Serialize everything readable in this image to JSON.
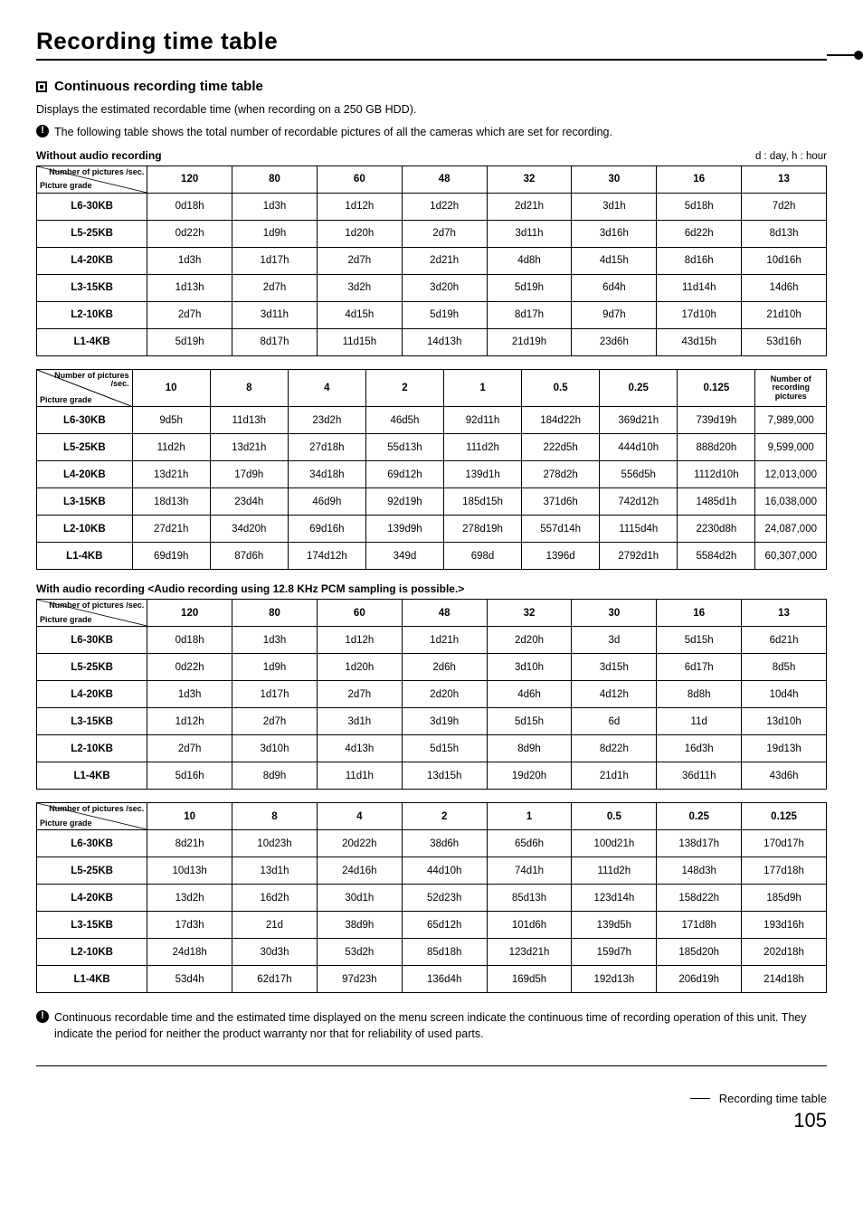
{
  "page_title": "Recording time table",
  "section_title": "Continuous recording time table",
  "intro": "Displays the estimated recordable time (when recording on a 250 GB HDD).",
  "note1": "The following table shows the total number of recordable pictures of all the cameras which are set for recording.",
  "caption1": "Without audio recording",
  "legend": "d : day, h : hour",
  "diag_top": "Number of pictures /sec.",
  "diag_bottom": "Picture grade",
  "extra_col_label": "Number of recording pictures",
  "caption2": "With audio recording <Audio recording using 12.8 KHz PCM sampling is possible.>",
  "note2": "Continuous recordable time and the estimated time displayed on the menu screen indicate the continuous time of recording operation of this unit. They indicate the period for neither the product warranty nor that for reliability of used parts.",
  "footer_label": "Recording time table",
  "page_number": "105",
  "row_labels": [
    "L6-30KB",
    "L5-25KB",
    "L4-20KB",
    "L3-15KB",
    "L2-10KB",
    "L1-4KB"
  ],
  "t1_cols": [
    "120",
    "80",
    "60",
    "48",
    "32",
    "30",
    "16",
    "13"
  ],
  "t1": [
    [
      "0d18h",
      "1d3h",
      "1d12h",
      "1d22h",
      "2d21h",
      "3d1h",
      "5d18h",
      "7d2h"
    ],
    [
      "0d22h",
      "1d9h",
      "1d20h",
      "2d7h",
      "3d11h",
      "3d16h",
      "6d22h",
      "8d13h"
    ],
    [
      "1d3h",
      "1d17h",
      "2d7h",
      "2d21h",
      "4d8h",
      "4d15h",
      "8d16h",
      "10d16h"
    ],
    [
      "1d13h",
      "2d7h",
      "3d2h",
      "3d20h",
      "5d19h",
      "6d4h",
      "11d14h",
      "14d6h"
    ],
    [
      "2d7h",
      "3d11h",
      "4d15h",
      "5d19h",
      "8d17h",
      "9d7h",
      "17d10h",
      "21d10h"
    ],
    [
      "5d19h",
      "8d17h",
      "11d15h",
      "14d13h",
      "21d19h",
      "23d6h",
      "43d15h",
      "53d16h"
    ]
  ],
  "t2_cols": [
    "10",
    "8",
    "4",
    "2",
    "1",
    "0.5",
    "0.25",
    "0.125"
  ],
  "t2": [
    [
      "9d5h",
      "11d13h",
      "23d2h",
      "46d5h",
      "92d11h",
      "184d22h",
      "369d21h",
      "739d19h"
    ],
    [
      "11d2h",
      "13d21h",
      "27d18h",
      "55d13h",
      "111d2h",
      "222d5h",
      "444d10h",
      "888d20h"
    ],
    [
      "13d21h",
      "17d9h",
      "34d18h",
      "69d12h",
      "139d1h",
      "278d2h",
      "556d5h",
      "1112d10h"
    ],
    [
      "18d13h",
      "23d4h",
      "46d9h",
      "92d19h",
      "185d15h",
      "371d6h",
      "742d12h",
      "1485d1h"
    ],
    [
      "27d21h",
      "34d20h",
      "69d16h",
      "139d9h",
      "278d19h",
      "557d14h",
      "1115d4h",
      "2230d8h"
    ],
    [
      "69d19h",
      "87d6h",
      "174d12h",
      "349d",
      "698d",
      "1396d",
      "2792d1h",
      "5584d2h"
    ]
  ],
  "t2_extra": [
    "7,989,000",
    "9,599,000",
    "12,013,000",
    "16,038,000",
    "24,087,000",
    "60,307,000"
  ],
  "t3_cols": [
    "120",
    "80",
    "60",
    "48",
    "32",
    "30",
    "16",
    "13"
  ],
  "t3": [
    [
      "0d18h",
      "1d3h",
      "1d12h",
      "1d21h",
      "2d20h",
      "3d",
      "5d15h",
      "6d21h"
    ],
    [
      "0d22h",
      "1d9h",
      "1d20h",
      "2d6h",
      "3d10h",
      "3d15h",
      "6d17h",
      "8d5h"
    ],
    [
      "1d3h",
      "1d17h",
      "2d7h",
      "2d20h",
      "4d6h",
      "4d12h",
      "8d8h",
      "10d4h"
    ],
    [
      "1d12h",
      "2d7h",
      "3d1h",
      "3d19h",
      "5d15h",
      "6d",
      "11d",
      "13d10h"
    ],
    [
      "2d7h",
      "3d10h",
      "4d13h",
      "5d15h",
      "8d9h",
      "8d22h",
      "16d3h",
      "19d13h"
    ],
    [
      "5d16h",
      "8d9h",
      "11d1h",
      "13d15h",
      "19d20h",
      "21d1h",
      "36d11h",
      "43d6h"
    ]
  ],
  "t4_cols": [
    "10",
    "8",
    "4",
    "2",
    "1",
    "0.5",
    "0.25",
    "0.125"
  ],
  "t4": [
    [
      "8d21h",
      "10d23h",
      "20d22h",
      "38d6h",
      "65d6h",
      "100d21h",
      "138d17h",
      "170d17h"
    ],
    [
      "10d13h",
      "13d1h",
      "24d16h",
      "44d10h",
      "74d1h",
      "111d2h",
      "148d3h",
      "177d18h"
    ],
    [
      "13d2h",
      "16d2h",
      "30d1h",
      "52d23h",
      "85d13h",
      "123d14h",
      "158d22h",
      "185d9h"
    ],
    [
      "17d3h",
      "21d",
      "38d9h",
      "65d12h",
      "101d6h",
      "139d5h",
      "171d8h",
      "193d16h"
    ],
    [
      "24d18h",
      "30d3h",
      "53d2h",
      "85d18h",
      "123d21h",
      "159d7h",
      "185d20h",
      "202d18h"
    ],
    [
      "53d4h",
      "62d17h",
      "97d23h",
      "136d4h",
      "169d5h",
      "192d13h",
      "206d19h",
      "214d18h"
    ]
  ]
}
